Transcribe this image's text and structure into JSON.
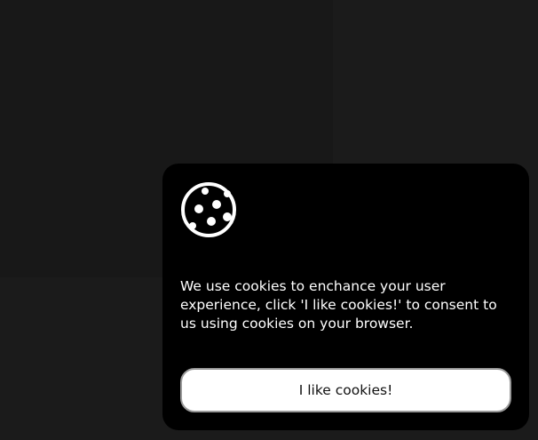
{
  "cookie_banner": {
    "icon": "cookie-icon",
    "message": "We use cookies to enchance your user experience, click 'I like cookies!' to consent to us using cookies on your browser.",
    "accept_label": "I like cookies!"
  },
  "colors": {
    "page_background": "#1b1b1b",
    "banner_background": "#000000",
    "button_background": "#ffffff",
    "text": "#ffffff"
  }
}
